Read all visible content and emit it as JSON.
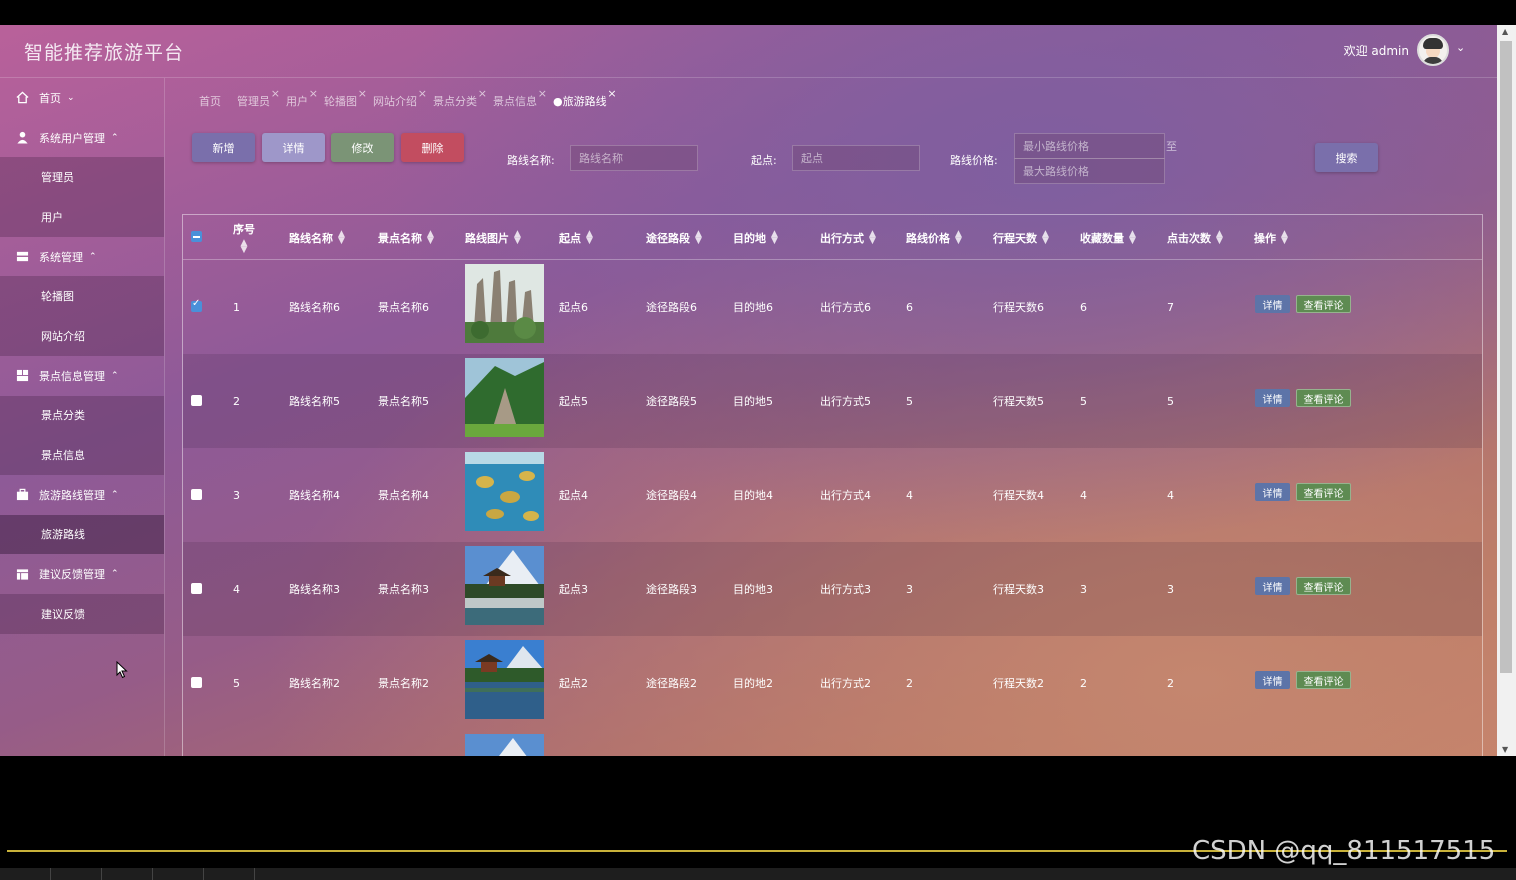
{
  "header": {
    "title": "智能推荐旅游平台",
    "welcome": "欢迎 admin"
  },
  "sidebar": {
    "items": [
      {
        "type": "group",
        "label": "首页",
        "icon": "home-icon",
        "caret": "⌄"
      },
      {
        "type": "group",
        "label": "系统用户管理",
        "icon": "user-icon",
        "caret": "⌃"
      },
      {
        "type": "sub",
        "label": "管理员"
      },
      {
        "type": "sub",
        "label": "用户"
      },
      {
        "type": "group",
        "label": "系统管理",
        "icon": "system-icon",
        "caret": "⌃"
      },
      {
        "type": "sub",
        "label": "轮播图"
      },
      {
        "type": "sub",
        "label": "网站介绍"
      },
      {
        "type": "group",
        "label": "景点信息管理",
        "icon": "grid-icon",
        "caret": "⌃"
      },
      {
        "type": "sub",
        "label": "景点分类"
      },
      {
        "type": "sub",
        "label": "景点信息"
      },
      {
        "type": "group",
        "label": "旅游路线管理",
        "icon": "briefcase-icon",
        "caret": "⌃"
      },
      {
        "type": "sub",
        "label": "旅游路线",
        "active": true
      },
      {
        "type": "group",
        "label": "建议反馈管理",
        "icon": "table-icon",
        "caret": "⌃"
      },
      {
        "type": "sub",
        "label": "建议反馈"
      }
    ]
  },
  "tabs": [
    {
      "label": "首页",
      "closable": false
    },
    {
      "label": "管理员",
      "closable": true
    },
    {
      "label": "用户",
      "closable": true
    },
    {
      "label": "轮播图",
      "closable": true
    },
    {
      "label": "网站介绍",
      "closable": true
    },
    {
      "label": "景点分类",
      "closable": true
    },
    {
      "label": "景点信息",
      "closable": true
    },
    {
      "label": "●旅游路线",
      "closable": true,
      "active": true
    }
  ],
  "toolbar": {
    "add": "新增",
    "detail": "详情",
    "edit": "修改",
    "delete": "删除",
    "search": "搜索"
  },
  "filters": {
    "route_name_label": "路线名称:",
    "route_name_placeholder": "路线名称",
    "start_label": "起点:",
    "start_placeholder": "起点",
    "price_label": "路线价格:",
    "min_price_placeholder": "最小路线价格",
    "max_price_placeholder": "最大路线价格",
    "to": "至"
  },
  "table": {
    "columns": [
      "序号",
      "路线名称",
      "景点名称",
      "路线图片",
      "起点",
      "途径路段",
      "目的地",
      "出行方式",
      "路线价格",
      "行程天数",
      "收藏数量",
      "点击次数",
      "操作"
    ],
    "rows": [
      {
        "checked": true,
        "no": "1",
        "route": "路线名称6",
        "spot": "景点名称6",
        "image": "karst-peaks",
        "start": "起点6",
        "via": "途径路段6",
        "dest": "目的地6",
        "mode": "出行方式6",
        "price": "6",
        "days": "行程天数6",
        "fav": "6",
        "clicks": "7"
      },
      {
        "checked": false,
        "no": "2",
        "route": "路线名称5",
        "spot": "景点名称5",
        "image": "green-mountain",
        "start": "起点5",
        "via": "途径路段5",
        "dest": "目的地5",
        "mode": "出行方式5",
        "price": "5",
        "days": "行程天数5",
        "fav": "5",
        "clicks": "5"
      },
      {
        "checked": false,
        "no": "3",
        "route": "路线名称4",
        "spot": "景点名称4",
        "image": "lake-islands",
        "start": "起点4",
        "via": "途径路段4",
        "dest": "目的地4",
        "mode": "出行方式4",
        "price": "4",
        "days": "行程天数4",
        "fav": "4",
        "clicks": "4"
      },
      {
        "checked": false,
        "no": "4",
        "route": "路线名称3",
        "spot": "景点名称3",
        "image": "pavilion-bridge",
        "start": "起点3",
        "via": "途径路段3",
        "dest": "目的地3",
        "mode": "出行方式3",
        "price": "3",
        "days": "行程天数3",
        "fav": "3",
        "clicks": "3"
      },
      {
        "checked": false,
        "no": "5",
        "route": "路线名称2",
        "spot": "景点名称2",
        "image": "pagoda-lake",
        "start": "起点2",
        "via": "途径路段2",
        "dest": "目的地2",
        "mode": "出行方式2",
        "price": "2",
        "days": "行程天数2",
        "fav": "2",
        "clicks": "2"
      }
    ],
    "op_detail": "详情",
    "op_comment": "查看评论"
  },
  "watermark": "CSDN @qq_811517515"
}
